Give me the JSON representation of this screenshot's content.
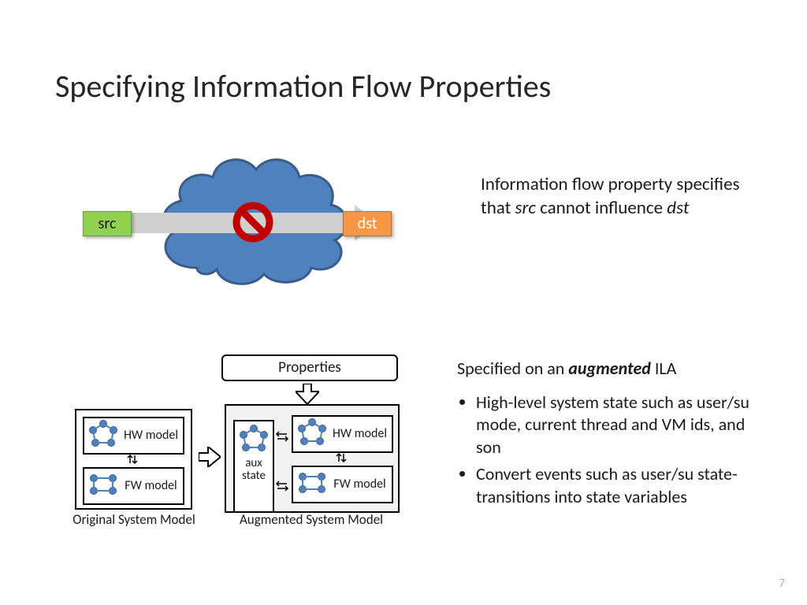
{
  "title": "Specifying Information Flow Properties",
  "top_diagram": {
    "src_label": "src",
    "dst_label": "dst"
  },
  "top_text": {
    "line": "Information flow property specifies that ",
    "src": "src",
    "mid": " cannot influence ",
    "dst": "dst"
  },
  "lower_diagram": {
    "properties_label": "Properties",
    "hw_model_label": "HW model",
    "fw_model_label": "FW model",
    "aux_state_label": "aux state",
    "original_caption": "Original System Model",
    "augmented_caption": "Augmented System Model"
  },
  "lower_text": {
    "lead_a": "Specified on an ",
    "lead_b": "augmented",
    "lead_c": " ILA",
    "bullets": [
      "High-level system state such as user/su mode, current thread and VM ids, and son",
      "Convert events such as user/su state-transitions into state variables"
    ]
  },
  "page_number": "7"
}
